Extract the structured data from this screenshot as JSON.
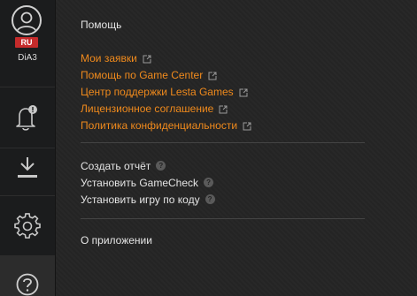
{
  "profile": {
    "language": "RU",
    "username": "DiA3"
  },
  "icons": {
    "avatar": "user-icon",
    "notifications": "bell-icon",
    "downloads": "download-icon",
    "settings": "gear-icon",
    "help": "help-icon",
    "external": "external-link-icon",
    "question": "question-icon"
  },
  "colors": {
    "accent": "#f08a1c",
    "language_badge": "#c52b2b"
  },
  "help_menu": {
    "title": "Помощь",
    "links": [
      "Мои заявки",
      "Помощь по Game Center",
      "Центр поддержки Lesta Games",
      "Лицензионное соглашение",
      "Политика конфиденциальности"
    ],
    "actions": [
      "Создать отчёт",
      "Установить GameCheck",
      "Установить игру по коду"
    ],
    "question_mark": "?",
    "about": "О приложении"
  }
}
